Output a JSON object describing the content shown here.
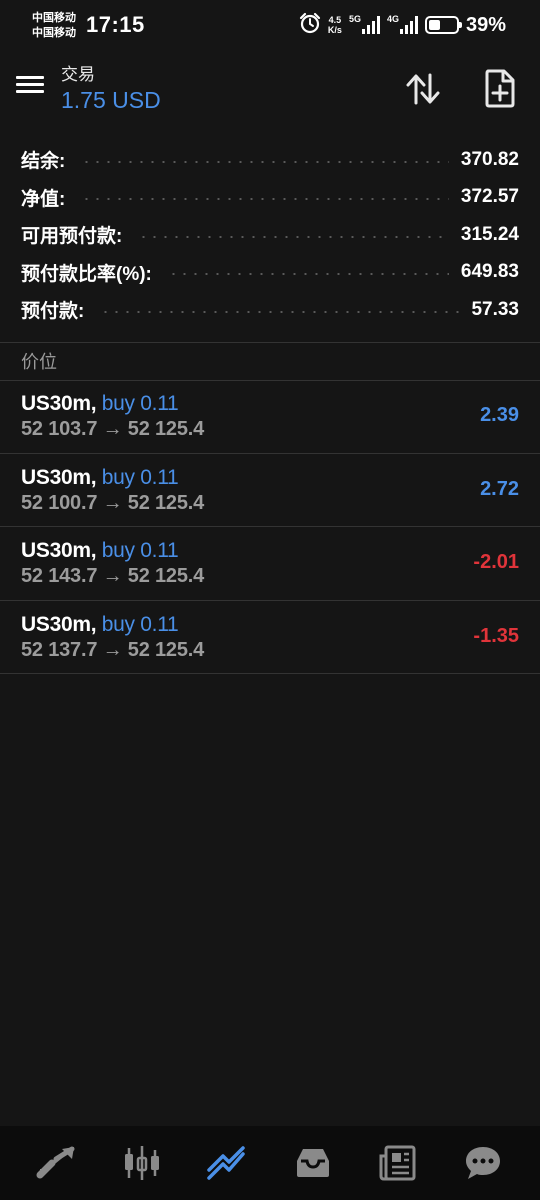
{
  "status_bar": {
    "carrier_1": "中国移动",
    "carrier_2": "中国移动",
    "time": "17:15",
    "net_speed_value": "4.5",
    "net_speed_unit": "K/s",
    "net_type_1": "5G",
    "net_type_2": "4G",
    "battery": "39%"
  },
  "header": {
    "title": "交易",
    "subtitle": "1.75 USD"
  },
  "summary": [
    {
      "label": "结余:",
      "value": "370.82"
    },
    {
      "label": "净值:",
      "value": "372.57"
    },
    {
      "label": "可用预付款:",
      "value": "315.24"
    },
    {
      "label": "预付款比率(%):",
      "value": "649.83"
    },
    {
      "label": "预付款:",
      "value": "57.33"
    }
  ],
  "section_title": "价位",
  "positions": [
    {
      "symbol": "US30m,",
      "side": "buy 0.11",
      "prices": "52 103.7 → 52 125.4",
      "profit": "2.39"
    },
    {
      "symbol": "US30m,",
      "side": "buy 0.11",
      "prices": "52 100.7 → 52 125.4",
      "profit": "2.72"
    },
    {
      "symbol": "US30m,",
      "side": "buy 0.11",
      "prices": "52 143.7 → 52 125.4",
      "profit": "-2.01"
    },
    {
      "symbol": "US30m,",
      "side": "buy 0.11",
      "prices": "52 137.7 → 52 125.4",
      "profit": "-1.35"
    }
  ],
  "colors": {
    "background": "#151515",
    "accent_blue": "#4a8fe7",
    "loss_red": "#e0343a",
    "muted": "#9c9c9c"
  },
  "bottom_nav": [
    {
      "icon": "quotes-icon",
      "active": false
    },
    {
      "icon": "chart-icon",
      "active": false
    },
    {
      "icon": "trade-icon",
      "active": true
    },
    {
      "icon": "history-icon",
      "active": false
    },
    {
      "icon": "news-icon",
      "active": false
    },
    {
      "icon": "chat-icon",
      "active": false
    }
  ]
}
